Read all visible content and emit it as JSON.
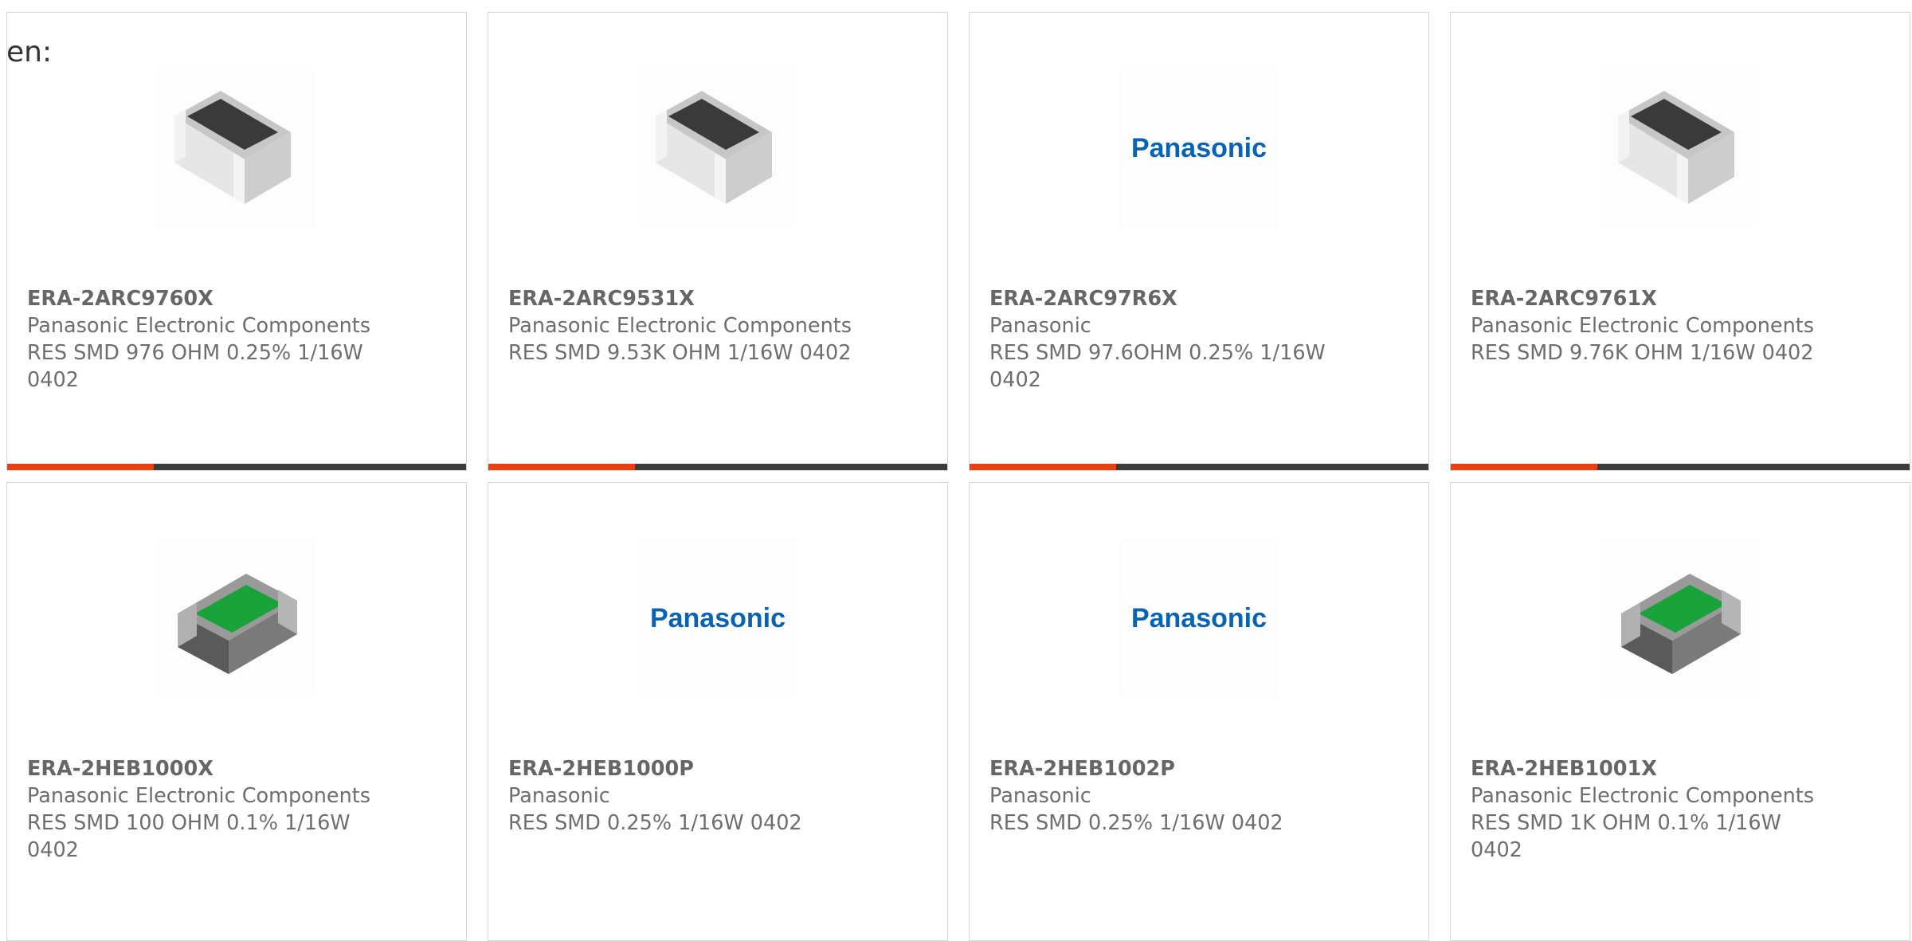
{
  "lead_text": "en:",
  "products": [
    {
      "part_number": "ERA-2ARC9760X",
      "manufacturer": "Panasonic Electronic Components",
      "description": "RES SMD 976 OHM 0.25% 1/16W 0402",
      "image": "chip-resistor-black-icon",
      "progress": 0.32
    },
    {
      "part_number": "ERA-2ARC9531X",
      "manufacturer": "Panasonic Electronic Components",
      "description": "RES SMD 9.53K OHM 1/16W 0402",
      "image": "chip-resistor-black-icon",
      "progress": 0.32
    },
    {
      "part_number": "ERA-2ARC97R6X",
      "manufacturer": "Panasonic",
      "description": "RES SMD 97.6OHM 0.25% 1/16W 0402",
      "image": "panasonic-logo",
      "logo_text": "Panasonic",
      "progress": 0.32
    },
    {
      "part_number": "ERA-2ARC9761X",
      "manufacturer": "Panasonic Electronic Components",
      "description": "RES SMD 9.76K OHM 1/16W 0402",
      "image": "chip-resistor-black-icon",
      "progress": 0.32
    },
    {
      "part_number": "ERA-2HEB1000X",
      "manufacturer": "Panasonic Electronic Components",
      "description": "RES SMD 100 OHM 0.1% 1/16W 0402",
      "image": "chip-resistor-green-icon",
      "progress": null
    },
    {
      "part_number": "ERA-2HEB1000P",
      "manufacturer": "Panasonic",
      "description": "RES SMD 0.25% 1/16W 0402",
      "image": "panasonic-logo",
      "logo_text": "Panasonic",
      "progress": null
    },
    {
      "part_number": "ERA-2HEB1002P",
      "manufacturer": "Panasonic",
      "description": "RES SMD 0.25% 1/16W 0402",
      "image": "panasonic-logo",
      "logo_text": "Panasonic",
      "progress": null
    },
    {
      "part_number": "ERA-2HEB1001X",
      "manufacturer": "Panasonic Electronic Components",
      "description": "RES SMD 1K OHM 0.1% 1/16W 0402",
      "image": "chip-resistor-green-icon",
      "progress": null
    }
  ],
  "colors": {
    "accent": "#e8400f",
    "bar_track": "#3c3c3c",
    "logo_blue": "#0a63b0",
    "resistor_green": "#1aa33a"
  }
}
